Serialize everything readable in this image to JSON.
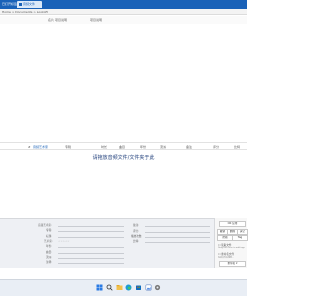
{
  "tabs": [
    {
      "label": "已打开标签"
    },
    {
      "label": "音频文件"
    }
  ],
  "breadcrumb": "Home > Documents > Lookoft",
  "subhead": {
    "col_a": "名片 项目说明",
    "col_b": "项目说明"
  },
  "columns": [
    "#",
    "音频艺术家",
    "专辑",
    "时长",
    "曲目",
    "年份",
    "流派",
    "备注",
    "评分",
    "比特"
  ],
  "drop_zone_text": "请拖放音频文件/文件夹于此",
  "properties": {
    "left_labels": [
      "音频艺术家:",
      "专辑:",
      "标题:",
      "艺术家:",
      "年份:",
      "曲目:",
      "流派:",
      "注释:"
    ],
    "right_labels": [
      "备注:",
      "评分:",
      "播放次数:",
      "比特:"
    ],
    "stars": "☆☆☆☆☆"
  },
  "side_panel": {
    "btn1": "OK 应用",
    "row2": [
      "撤销",
      "删除",
      "清空"
    ],
    "row3": [
      "帮助",
      "Tag"
    ],
    "check1": "☐ 读取文件",
    "hint": "Drag files here to add tags",
    "check2": "☐ 重命名文件",
    "hint2": "包括文件名规则...",
    "btn_bottom": "重命名 ▾"
  },
  "taskbar_icons": [
    "windows-start",
    "search",
    "file-explorer",
    "edge",
    "store",
    "photos",
    "settings"
  ]
}
